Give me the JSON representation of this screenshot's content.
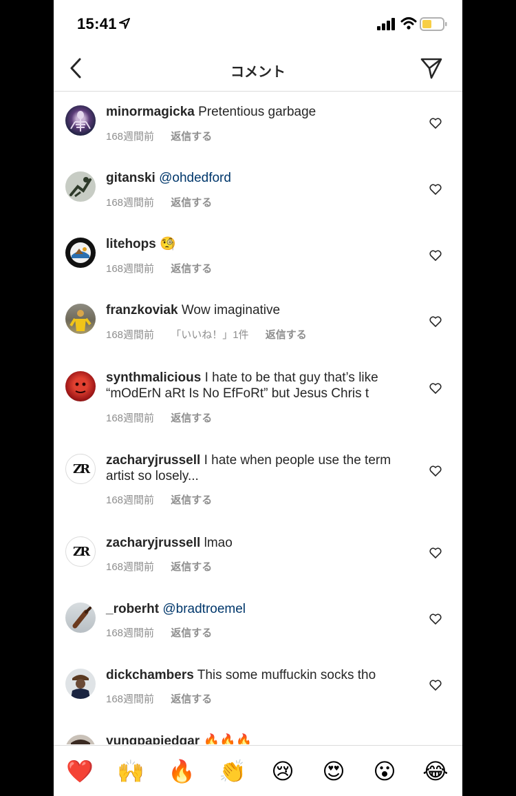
{
  "status_bar": {
    "time": "15:41"
  },
  "header": {
    "title": "コメント"
  },
  "comments": [
    {
      "username": "minormagicka",
      "text": "Pretentious garbage",
      "mention": "",
      "age": "168週間前",
      "likes": "",
      "reply": "返信する"
    },
    {
      "username": "gitanski",
      "text": "",
      "mention": "@ohdedford",
      "age": "168週間前",
      "likes": "",
      "reply": "返信する"
    },
    {
      "username": "litehops",
      "text": "🧐",
      "mention": "",
      "age": "168週間前",
      "likes": "",
      "reply": "返信する"
    },
    {
      "username": "franzkoviak",
      "text": "Wow imaginative",
      "mention": "",
      "age": "168週間前",
      "likes": "「いいね！」1件",
      "reply": "返信する"
    },
    {
      "username": "synthmalicious",
      "text": "I hate to be that guy that’s like “mOdErN aRt Is No EfFoRt” but Jesus Chris t",
      "mention": "",
      "age": "168週間前",
      "likes": "",
      "reply": "返信する"
    },
    {
      "username": "zacharyjrussell",
      "text": "I hate when people use the term artist so losely...",
      "mention": "",
      "age": "168週間前",
      "likes": "",
      "reply": "返信する"
    },
    {
      "username": "zacharyjrussell",
      "text": "lmao",
      "mention": "",
      "age": "168週間前",
      "likes": "",
      "reply": "返信する"
    },
    {
      "username": "_roberht",
      "text": "",
      "mention": "@bradtroemel",
      "age": "168週間前",
      "likes": "",
      "reply": "返信する"
    },
    {
      "username": "dickchambers",
      "text": "This some muffuckin socks tho",
      "mention": "",
      "age": "168週間前",
      "likes": "",
      "reply": "返信する"
    },
    {
      "username": "yungpapiedgar",
      "text": "🔥🔥🔥",
      "mention": "",
      "age": "",
      "likes": "",
      "reply": ""
    }
  ],
  "avatar_initials": {
    "zacharyjrussell": "ZR"
  },
  "emoji_bar": [
    "❤️",
    "🙌",
    "🔥",
    "👏",
    "😢",
    "😍",
    "😮",
    "😂"
  ],
  "colors": {
    "mention": "#00376b",
    "meta": "#8e8e8e",
    "text": "#262626",
    "heart_red": "#ed4956",
    "battery": "#f7ce46"
  }
}
